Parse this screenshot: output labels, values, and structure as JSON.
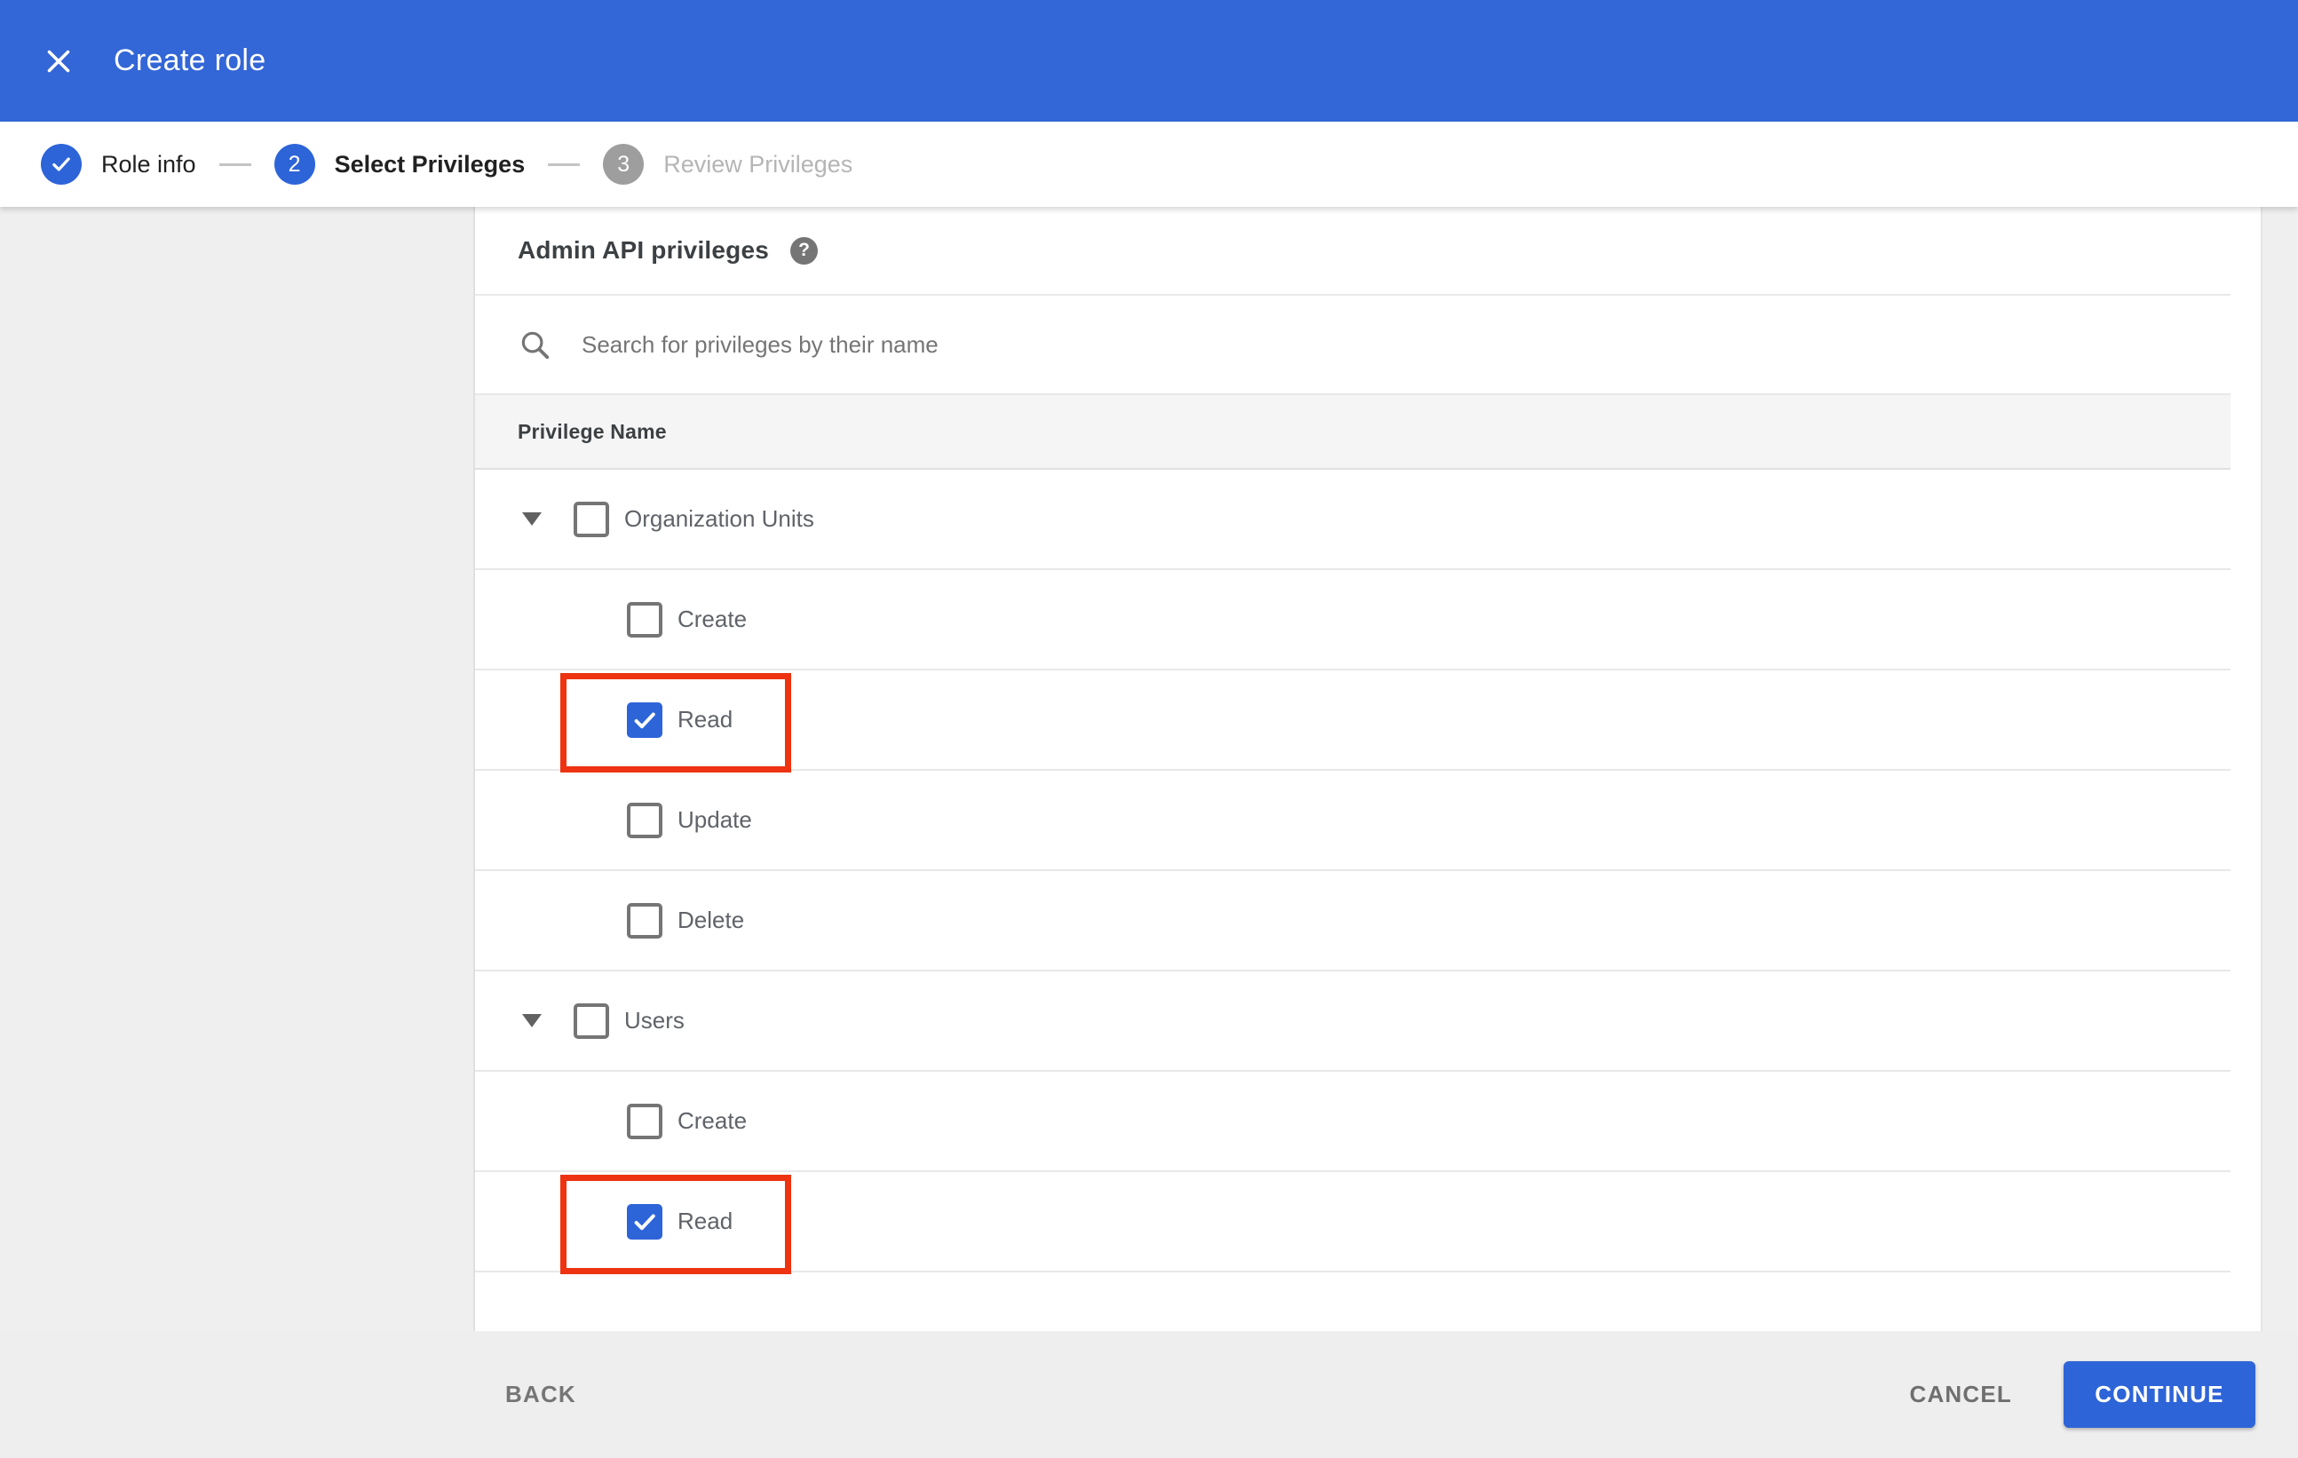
{
  "app_bar": {
    "title": "Create role"
  },
  "stepper": {
    "steps": [
      {
        "label": "Role info",
        "state": "completed",
        "number": ""
      },
      {
        "label": "Select Privileges",
        "state": "active",
        "number": "2"
      },
      {
        "label": "Review Privileges",
        "state": "upcoming",
        "number": "3"
      }
    ]
  },
  "content": {
    "heading": "Admin API privileges",
    "help_icon_glyph": "?",
    "search": {
      "placeholder": "Search for privileges by their name",
      "value": ""
    },
    "table": {
      "header": "Privilege Name",
      "groups": [
        {
          "label": "Organization Units",
          "checked": false,
          "expanded": true,
          "children": [
            {
              "label": "Create",
              "checked": false,
              "highlighted": false
            },
            {
              "label": "Read",
              "checked": true,
              "highlighted": true
            },
            {
              "label": "Update",
              "checked": false,
              "highlighted": false
            },
            {
              "label": "Delete",
              "checked": false,
              "highlighted": false
            }
          ]
        },
        {
          "label": "Users",
          "checked": false,
          "expanded": true,
          "children": [
            {
              "label": "Create",
              "checked": false,
              "highlighted": false
            },
            {
              "label": "Read",
              "checked": true,
              "highlighted": true
            }
          ]
        }
      ]
    }
  },
  "footer": {
    "back": "BACK",
    "cancel": "CANCEL",
    "continue": "CONTINUE"
  },
  "colors": {
    "app_bar_blue": "#3366d6",
    "accent_blue": "#2d64d8",
    "annotation_red": "#ee3312",
    "side_background_gray": "#efefef",
    "table_header_gray": "#f5f5f5"
  }
}
